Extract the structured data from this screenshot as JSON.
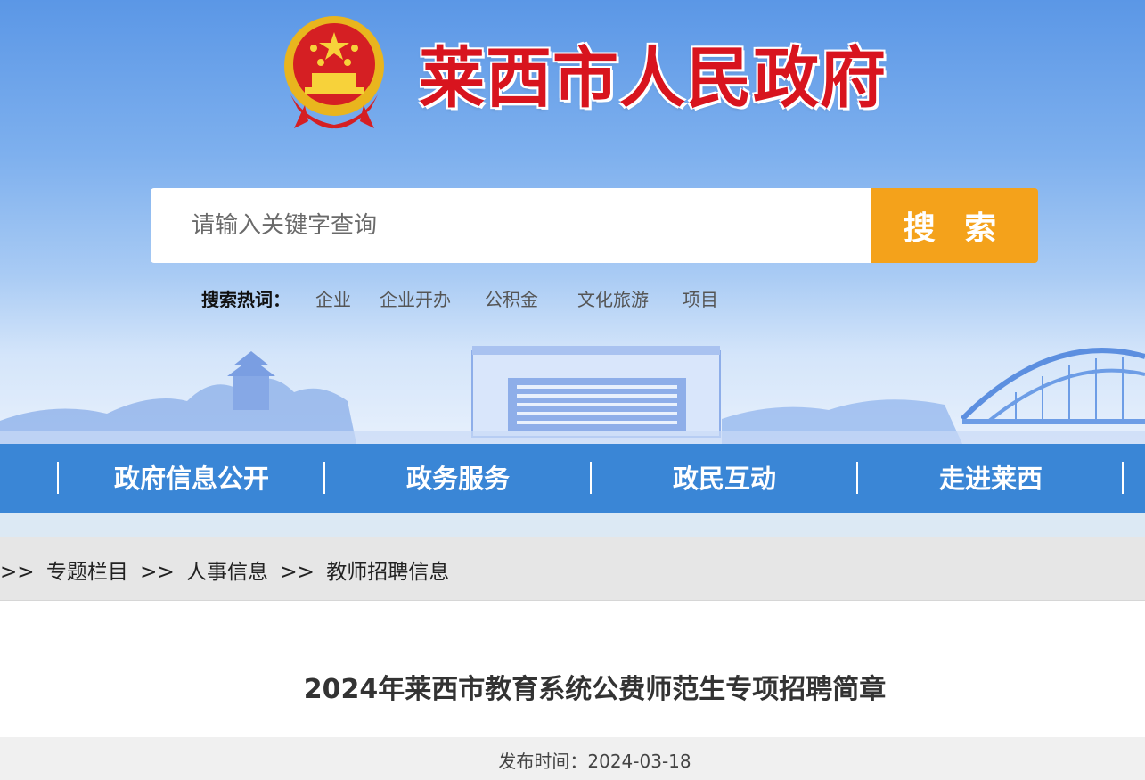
{
  "header": {
    "site_title": "莱西市人民政府",
    "emblem": "national-emblem-icon"
  },
  "search": {
    "placeholder": "请输入关键字查询",
    "button_label": "搜 索",
    "hot_label": "搜索热词：",
    "hot_words": [
      "企业",
      "企业开办",
      "公积金",
      "文化旅游",
      "项目"
    ]
  },
  "nav": {
    "items": [
      "政府信息公开",
      "政务服务",
      "政民互动",
      "走进莱西"
    ]
  },
  "breadcrumb": {
    "prefix": ">>",
    "separator": ">>",
    "items": [
      "专题栏目",
      "人事信息",
      "教师招聘信息"
    ]
  },
  "article": {
    "title": "2024年莱西市教育系统公费师范生专项招聘简章",
    "publish_label": "发布时间：",
    "publish_date": "2024-03-18"
  },
  "colors": {
    "title_red": "#d8141e",
    "search_button": "#f4a21b",
    "nav_blue": "#3a86d6"
  }
}
